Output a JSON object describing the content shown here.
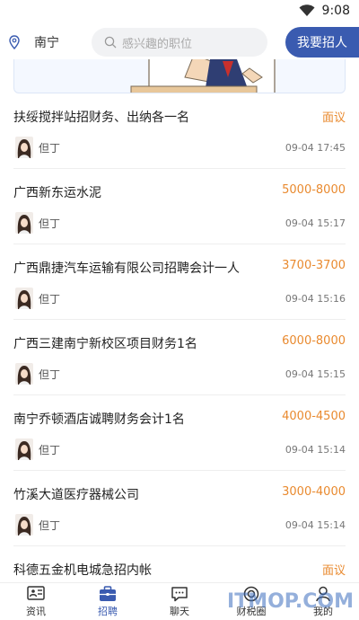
{
  "status_bar": {
    "time": "9:08"
  },
  "header": {
    "location": "南宁",
    "search_placeholder": "感兴趣的职位",
    "post_button": "我要招人"
  },
  "jobs": [
    {
      "title": "扶绥搅拌站招财务、出纳各一名",
      "salary": "面议",
      "poster": "但丁",
      "time": "09-04 17:45"
    },
    {
      "title": "广西新东运水泥",
      "salary": "5000-8000",
      "poster": "但丁",
      "time": "09-04 15:17"
    },
    {
      "title": "广西鼎捷汽车运输有限公司招聘会计一人",
      "salary": "3700-3700",
      "poster": "但丁",
      "time": "09-04 15:16"
    },
    {
      "title": "广西三建南宁新校区项目财务1名",
      "salary": "6000-8000",
      "poster": "但丁",
      "time": "09-04 15:15"
    },
    {
      "title": "南宁乔顿酒店诚聘财务会计1名",
      "salary": "4000-4500",
      "poster": "但丁",
      "time": "09-04 15:14"
    },
    {
      "title": "竹溪大道医疗器械公司",
      "salary": "3000-4000",
      "poster": "但丁",
      "time": "09-04 15:14"
    },
    {
      "title": "科德五金机电城急招内帐",
      "salary": "面议",
      "poster": "",
      "time": ""
    }
  ],
  "tabs": [
    {
      "label": "资讯",
      "icon": "news-icon"
    },
    {
      "label": "招聘",
      "icon": "briefcase-icon"
    },
    {
      "label": "聊天",
      "icon": "chat-icon"
    },
    {
      "label": "财税圈",
      "icon": "circle-icon"
    },
    {
      "label": "我的",
      "icon": "person-icon"
    }
  ],
  "active_tab": "招聘",
  "watermark": "ITMOP.COM",
  "colors": {
    "accent": "#3a5bb0",
    "salary": "#e98a2f"
  }
}
